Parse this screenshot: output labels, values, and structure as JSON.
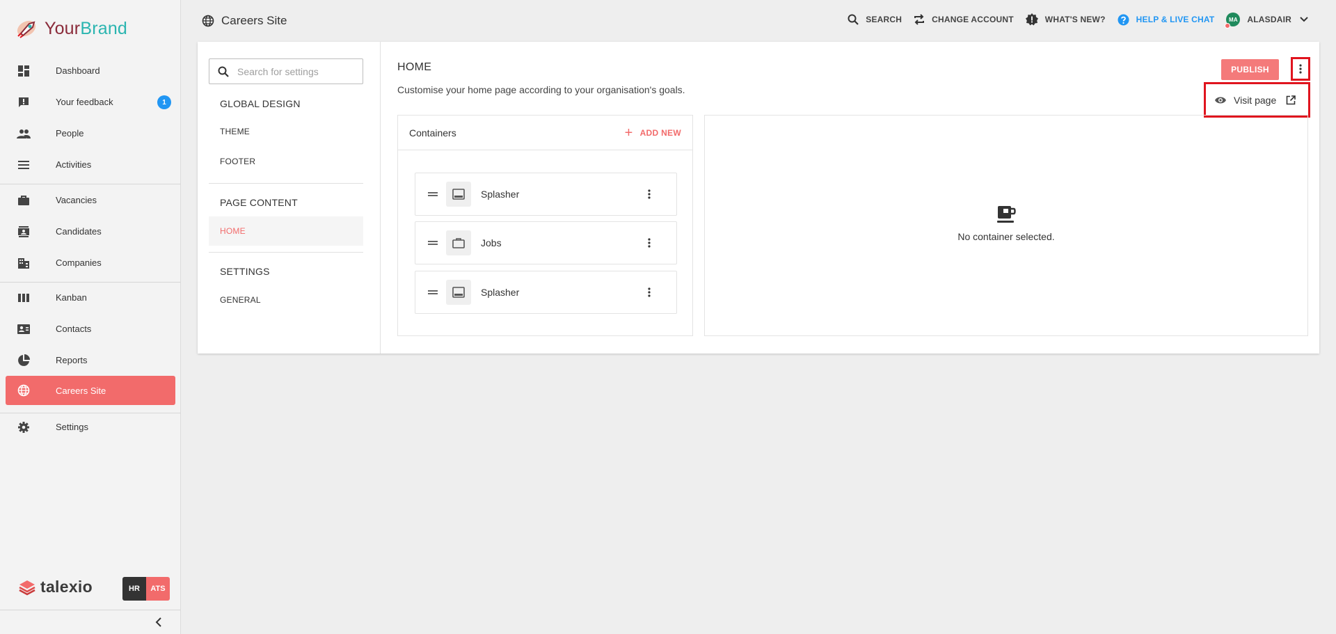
{
  "brand": {
    "part1": "Your",
    "part2": "Brand"
  },
  "sidebar": {
    "items": [
      {
        "label": "Dashboard",
        "icon": "dashboard-icon"
      },
      {
        "label": "Your feedback",
        "icon": "feedback-icon",
        "badge": "1"
      },
      {
        "label": "People",
        "icon": "people-icon"
      },
      {
        "label": "Activities",
        "icon": "activities-icon"
      },
      {
        "label": "Vacancies",
        "icon": "briefcase-icon"
      },
      {
        "label": "Candidates",
        "icon": "candidates-icon"
      },
      {
        "label": "Companies",
        "icon": "building-icon"
      },
      {
        "label": "Kanban",
        "icon": "kanban-icon"
      },
      {
        "label": "Contacts",
        "icon": "contacts-icon"
      },
      {
        "label": "Reports",
        "icon": "pie-chart-icon"
      },
      {
        "label": "Careers Site",
        "icon": "globe-icon",
        "active": true
      },
      {
        "label": "Settings",
        "icon": "gear-icon"
      }
    ],
    "footer": {
      "logo": "talexio",
      "hr": "HR",
      "ats": "ATS"
    }
  },
  "topbar": {
    "title": "Careers Site",
    "search": "SEARCH",
    "change_account": "CHANGE ACCOUNT",
    "whats_new": "WHAT'S NEW?",
    "help": "HELP & LIVE CHAT",
    "avatar_initials": "MA",
    "user": "ALASDAIR"
  },
  "settings": {
    "search_placeholder": "Search for settings",
    "global_design": "GLOBAL DESIGN",
    "theme": "THEME",
    "footer": "FOOTER",
    "page_content": "PAGE CONTENT",
    "home": "HOME",
    "settings_heading": "SETTINGS",
    "general": "GENERAL"
  },
  "content": {
    "title": "HOME",
    "description": "Customise your home page according to your organisation's goals.",
    "publish": "PUBLISH",
    "visit_page": "Visit page",
    "containers_title": "Containers",
    "add_new": "ADD NEW",
    "containers": [
      {
        "label": "Splasher",
        "icon": "monitor-icon"
      },
      {
        "label": "Jobs",
        "icon": "briefcase-icon"
      },
      {
        "label": "Splasher",
        "icon": "monitor-icon"
      }
    ],
    "empty_text": "No container selected."
  },
  "colors": {
    "accent": "#f26b6b",
    "help": "#2196f3",
    "highlight": "#e0141e",
    "brand_your": "#8a2b3a",
    "brand_brand": "#2bb5b0"
  }
}
